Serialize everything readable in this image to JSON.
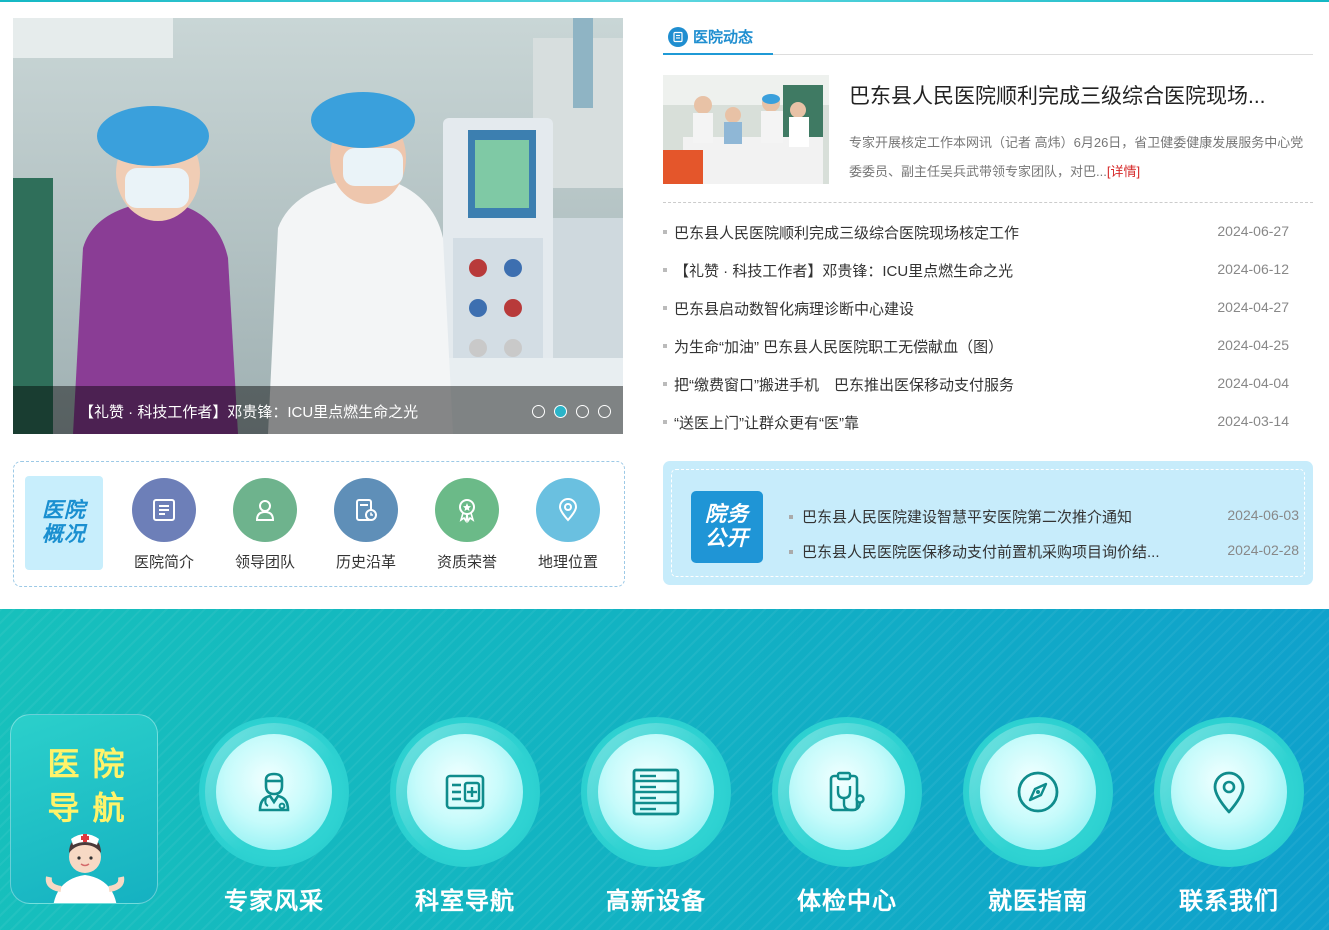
{
  "slider": {
    "caption": "【礼赞 · 科技工作者】邓贵锋：ICU里点燃生命之光",
    "slide_count": 4,
    "active_index": 1
  },
  "overview": {
    "label_line1": "医院",
    "label_line2": "概况",
    "items": [
      {
        "label": "医院简介",
        "icon": "document-icon",
        "color": "#6d7fb8"
      },
      {
        "label": "领导团队",
        "icon": "person-icon",
        "color": "#6eb38d"
      },
      {
        "label": "历史沿革",
        "icon": "history-icon",
        "color": "#5f8fb8"
      },
      {
        "label": "资质荣誉",
        "icon": "award-icon",
        "color": "#6bba88"
      },
      {
        "label": "地理位置",
        "icon": "location-icon",
        "color": "#6ac0e0"
      }
    ]
  },
  "news": {
    "tab_label": "医院动态",
    "featured": {
      "title": "巴东县人民医院顺利完成三级综合医院现场...",
      "summary": "专家开展核定工作本网讯（记者 高炜）6月26日，省卫健委健康发展服务中心党委委员、副主任吴兵武带领专家团队，对巴...",
      "more": "[详情]"
    },
    "items": [
      {
        "title": "巴东县人民医院顺利完成三级综合医院现场核定工作",
        "date": "2024-06-27"
      },
      {
        "title": "【礼赞 · 科技工作者】邓贵锋：ICU里点燃生命之光",
        "date": "2024-06-12"
      },
      {
        "title": "巴东县启动数智化病理诊断中心建设",
        "date": "2024-04-27"
      },
      {
        "title": "为生命“加油” 巴东县人民医院职工无偿献血（图）",
        "date": "2024-04-25"
      },
      {
        "title": "把“缴费窗口”搬进手机　巴东推出医保移动支付服务",
        "date": "2024-04-04"
      },
      {
        "title": "“送医上门”让群众更有“医”靠",
        "date": "2024-03-14"
      }
    ]
  },
  "affairs": {
    "label_line1": "院务",
    "label_line2": "公开",
    "items": [
      {
        "title": "巴东县人民医院建设智慧平安医院第二次推介通知",
        "date": "2024-06-03"
      },
      {
        "title": "巴东县人民医院医保移动支付前置机采购项目询价结...",
        "date": "2024-02-28"
      }
    ]
  },
  "guide": {
    "label_chars": [
      "医",
      "院",
      "导",
      "航"
    ],
    "items": [
      {
        "label": "专家风采",
        "icon": "doctor-icon"
      },
      {
        "label": "科室导航",
        "icon": "department-icon"
      },
      {
        "label": "高新设备",
        "icon": "equipment-icon"
      },
      {
        "label": "体检中心",
        "icon": "stethoscope-icon"
      },
      {
        "label": "就医指南",
        "icon": "compass-icon"
      },
      {
        "label": "联系我们",
        "icon": "location-icon"
      }
    ]
  }
}
